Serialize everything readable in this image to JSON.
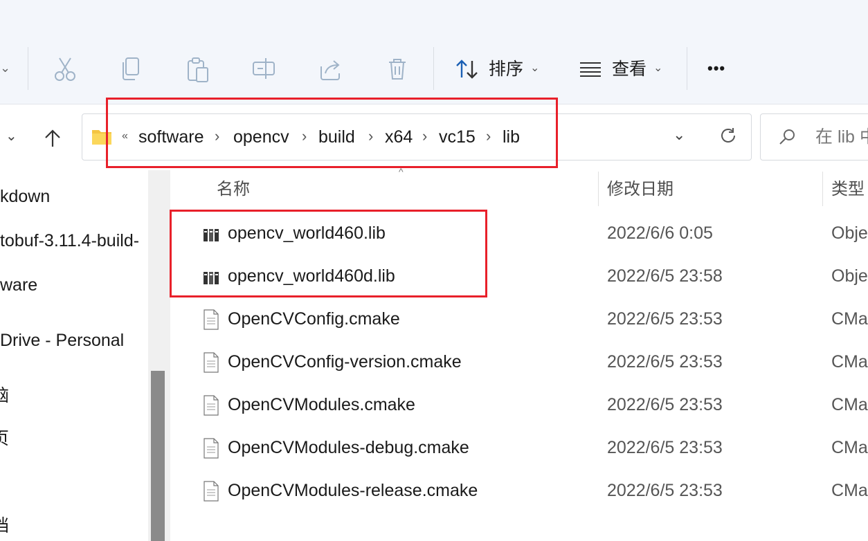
{
  "toolbar": {
    "sort_label": "排序",
    "view_label": "查看",
    "more_label": "•••"
  },
  "address": {
    "overflow": "«",
    "crumbs": [
      "software",
      "opencv",
      "build",
      "x64",
      "vc15",
      "lib"
    ]
  },
  "search": {
    "placeholder": "在 lib 中"
  },
  "nav": {
    "items": [
      "kdown",
      "tobuf-3.11.4-build-",
      "ware",
      "Drive - Personal",
      "脑",
      "页",
      "-",
      "档"
    ]
  },
  "columns": {
    "name": "名称",
    "modified": "修改日期",
    "type": "类型"
  },
  "files": [
    {
      "name": "opencv_world460.lib",
      "modified": "2022/6/6 0:05",
      "type": "Obje",
      "icon": "lib-file-icon"
    },
    {
      "name": "opencv_world460d.lib",
      "modified": "2022/6/5 23:58",
      "type": "Obje",
      "icon": "lib-file-icon"
    },
    {
      "name": "OpenCVConfig.cmake",
      "modified": "2022/6/5 23:53",
      "type": "CMa",
      "icon": "text-file-icon"
    },
    {
      "name": "OpenCVConfig-version.cmake",
      "modified": "2022/6/5 23:53",
      "type": "CMa",
      "icon": "text-file-icon"
    },
    {
      "name": "OpenCVModules.cmake",
      "modified": "2022/6/5 23:53",
      "type": "CMa",
      "icon": "text-file-icon"
    },
    {
      "name": "OpenCVModules-debug.cmake",
      "modified": "2022/6/5 23:53",
      "type": "CMa",
      "icon": "text-file-icon"
    },
    {
      "name": "OpenCVModules-release.cmake",
      "modified": "2022/6/5 23:53",
      "type": "CMa",
      "icon": "text-file-icon"
    }
  ],
  "colors": {
    "highlight_box": "#e8202a",
    "toolbar_bg": "#f3f6fb",
    "folder": "#f4c542"
  }
}
